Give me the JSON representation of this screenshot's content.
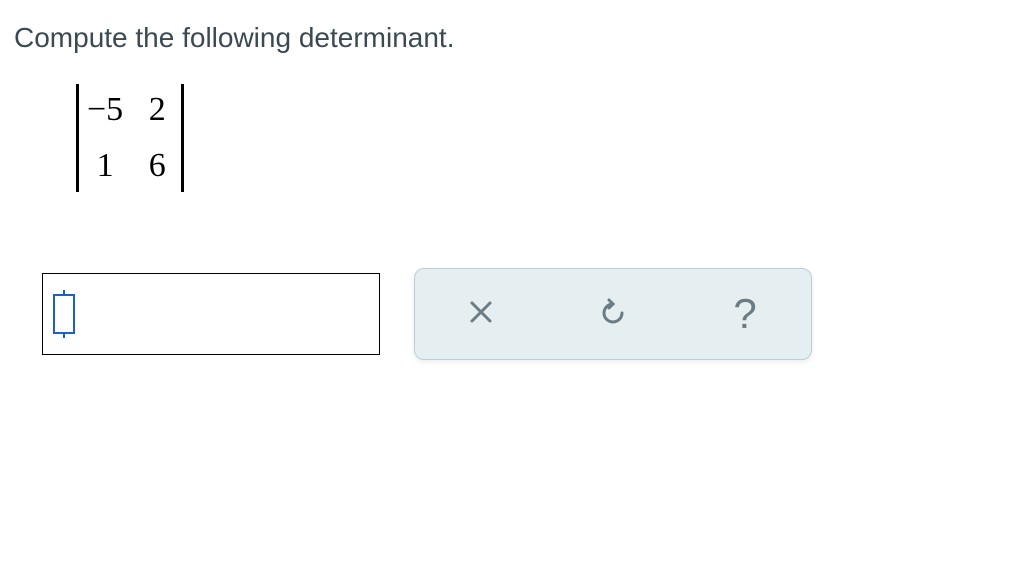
{
  "prompt": "Compute the following determinant.",
  "matrix": {
    "r1c1": "−5",
    "r1c2": "2",
    "r2c1": "1",
    "r2c2": "6"
  },
  "answer_value": "",
  "toolbar": {
    "clear_label": "clear",
    "undo_label": "undo",
    "help_label": "?"
  }
}
